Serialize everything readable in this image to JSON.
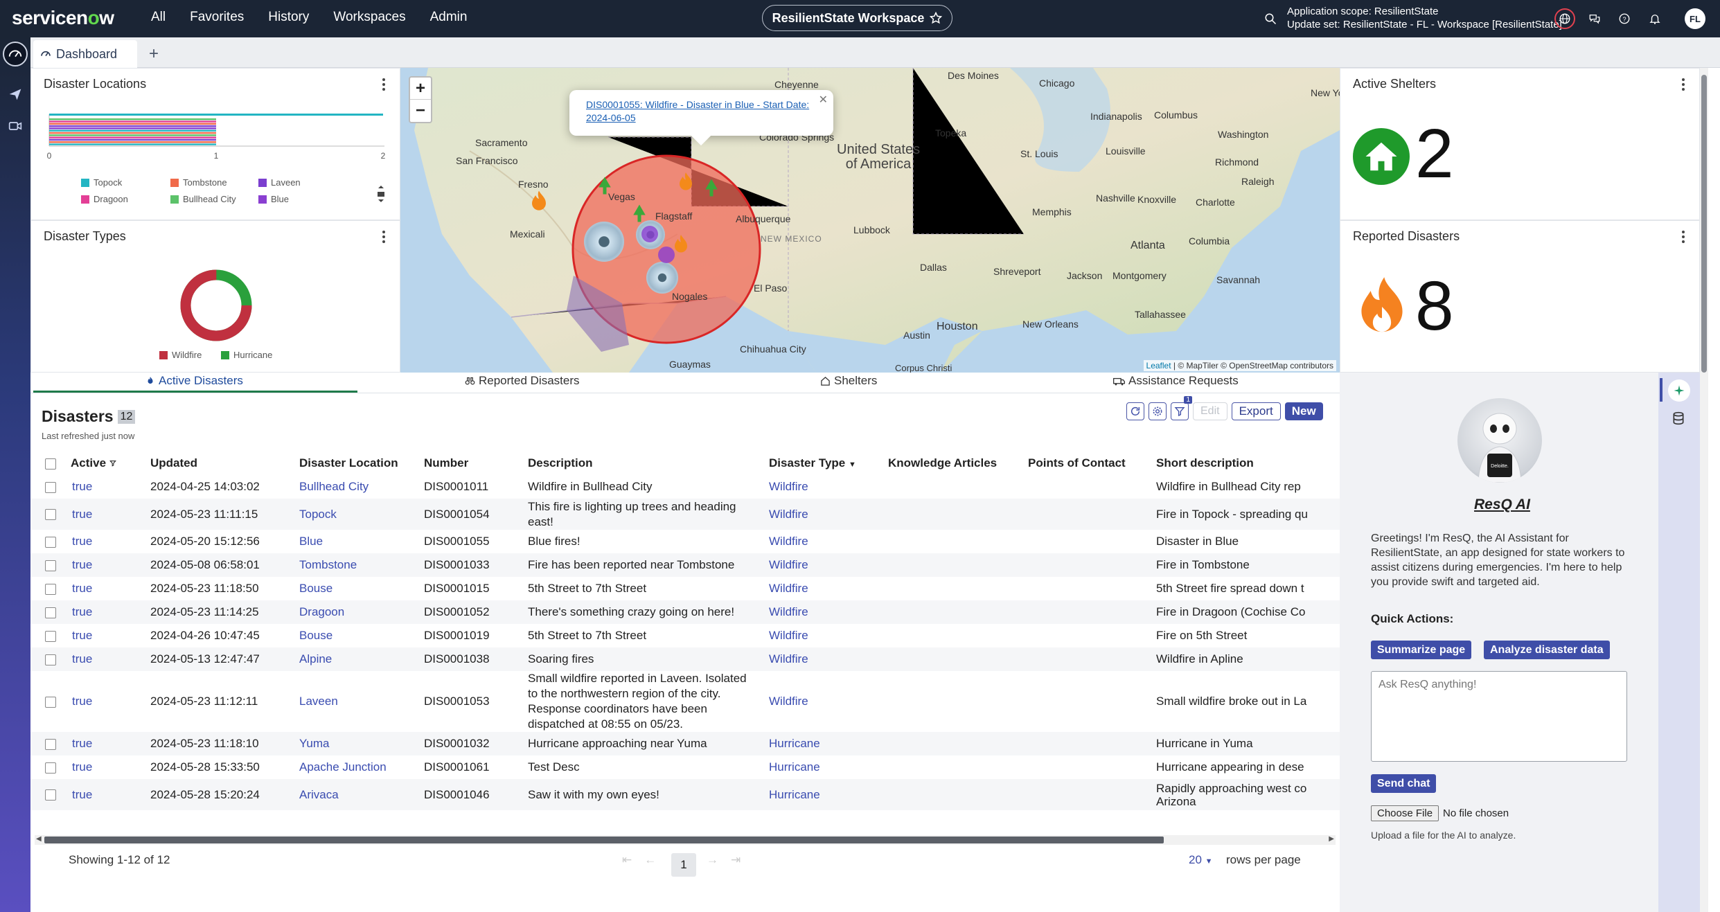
{
  "topnav": {
    "logo_a": "servicen",
    "logo_o": "o",
    "logo_b": "w",
    "menu": [
      "All",
      "Favorites",
      "History",
      "Workspaces",
      "Admin"
    ],
    "workspace": "ResilientState Workspace",
    "scope_line1": "Application scope: ResilientState",
    "scope_line2": "Update set: ResilientState - FL - Workspace [ResilientState]",
    "avatar": "FL"
  },
  "tabs": {
    "dashboard": "Dashboard"
  },
  "disaster_locations": {
    "title": "Disaster Locations",
    "axis_ticks": [
      "0",
      "1",
      "2"
    ],
    "legend": [
      {
        "label": "Topock",
        "color": "#23b5c3"
      },
      {
        "label": "Tombstone",
        "color": "#f06a4a"
      },
      {
        "label": "Laveen",
        "color": "#7b3fcf"
      },
      {
        "label": "Dragoon",
        "color": "#e33f96"
      },
      {
        "label": "Bullhead City",
        "color": "#5cc26a"
      },
      {
        "label": "Blue",
        "color": "#8a3fd1"
      }
    ]
  },
  "disaster_types": {
    "title": "Disaster Types",
    "legend": [
      {
        "label": "Wildfire",
        "color": "#c0303f"
      },
      {
        "label": "Hurricane",
        "color": "#2aa03c"
      }
    ],
    "wildfire_share": 0.75
  },
  "map": {
    "popup": "DIS0001055: Wildfire - Disaster in Blue - Start Date: 2024-06-05",
    "attribution_a": "Leaflet",
    "attribution_b": " | © MapTiler © OpenStreetMap contributors",
    "labels": {
      "cheyenne": "Cheyenne",
      "desmoines": "Des Moines",
      "sacramento": "Sacramento",
      "sanfrancisco": "San Francisco",
      "fresno": "Fresno",
      "lasvegas": "Vegas",
      "flagstaff": "Flagstaff",
      "albuquerque": "Albuquerque",
      "newmexico": "NEW MEXICO",
      "colorado": "Colorado Springs",
      "usa1": "United States",
      "usa2": "of America",
      "topeka": "Topeka",
      "chicago": "Chicago",
      "indianapolis": "Indianapolis",
      "columbus": "Columbus",
      "washington": "Washington",
      "stlouis": "St. Louis",
      "louisville": "Louisville",
      "richmond": "Richmond",
      "nashville": "Nashville",
      "knoxville": "Knoxville",
      "charlotte": "Charlotte",
      "memphis": "Memphis",
      "raleigh": "Raleigh",
      "atlanta": "Atlanta",
      "columbia": "Columbia",
      "lubbock": "Lubbock",
      "dallas": "Dallas",
      "shreveport": "Shreveport",
      "jackson": "Jackson",
      "montgomery": "Montgomery",
      "savannah": "Savannah",
      "elpaso": "El Paso",
      "austin": "Austin",
      "houston": "Houston",
      "neworleans": "New Orleans",
      "tallahassee": "Tallahassee",
      "nogales": "Nogales",
      "chihuahua": "Chihuahua City",
      "corpus": "Corpus Christi",
      "guaymas": "Guaymas",
      "mexicali": "Mexicali",
      "newyork": "New Yo"
    }
  },
  "active_shelters": {
    "title": "Active Shelters",
    "count": "2"
  },
  "reported_disasters": {
    "title": "Reported Disasters",
    "count": "8"
  },
  "subtabs": [
    "Active Disasters",
    "Reported Disasters",
    "Shelters",
    "Assistance Requests"
  ],
  "list": {
    "title": "Disasters",
    "count": "12",
    "refreshed": "Last refreshed just now",
    "buttons": {
      "edit": "Edit",
      "export": "Export",
      "new": "New"
    },
    "filter_badge": "1",
    "columns": [
      "Active",
      "Updated",
      "Disaster Location",
      "Number",
      "Description",
      "Disaster Type",
      "Knowledge Articles",
      "Points of Contact",
      "Short description"
    ],
    "rows": [
      {
        "active": "true",
        "updated": "2024-04-25 14:03:02",
        "location": "Bullhead City",
        "number": "DIS0001011",
        "description": "Wildfire in Bullhead City",
        "type": "Wildfire",
        "short": "Wildfire in Bullhead City rep"
      },
      {
        "active": "true",
        "updated": "2024-05-23 11:11:15",
        "location": "Topock",
        "number": "DIS0001054",
        "description": "This fire is lighting up trees and heading east!",
        "type": "Wildfire",
        "short": "Fire in Topock - spreading qu"
      },
      {
        "active": "true",
        "updated": "2024-05-20 15:12:56",
        "location": "Blue",
        "number": "DIS0001055",
        "description": "Blue fires!",
        "type": "Wildfire",
        "short": "Disaster in Blue"
      },
      {
        "active": "true",
        "updated": "2024-05-08 06:58:01",
        "location": "Tombstone",
        "number": "DIS0001033",
        "description": "Fire has been reported near Tombstone",
        "type": "Wildfire",
        "short": "Fire in Tombstone"
      },
      {
        "active": "true",
        "updated": "2024-05-23 11:18:50",
        "location": "Bouse",
        "number": "DIS0001015",
        "description": "5th Street to 7th Street",
        "type": "Wildfire",
        "short": "5th Street fire spread down t"
      },
      {
        "active": "true",
        "updated": "2024-05-23 11:14:25",
        "location": "Dragoon",
        "number": "DIS0001052",
        "description": "There's something crazy going on here!",
        "type": "Wildfire",
        "short": "Fire in Dragoon (Cochise Co"
      },
      {
        "active": "true",
        "updated": "2024-04-26 10:47:45",
        "location": "Bouse",
        "number": "DIS0001019",
        "description": "5th Street to 7th Street",
        "type": "Wildfire",
        "short": "Fire on 5th Street"
      },
      {
        "active": "true",
        "updated": "2024-05-13 12:47:47",
        "location": "Alpine",
        "number": "DIS0001038",
        "description": "Soaring fires",
        "type": "Wildfire",
        "short": "Wildfire in Apline"
      },
      {
        "active": "true",
        "updated": "2024-05-23 11:12:11",
        "location": "Laveen",
        "number": "DIS0001053",
        "description": "Small wildfire reported in Laveen. Isolated to the northwestern region of the city. Response coordinators have been dispatched at 08:55 on 05/23.",
        "type": "Wildfire",
        "short": "Small wildfire broke out in La"
      },
      {
        "active": "true",
        "updated": "2024-05-23 11:18:10",
        "location": "Yuma",
        "number": "DIS0001032",
        "description": "Hurricane approaching near Yuma",
        "type": "Hurricane",
        "short": "Hurricane in Yuma"
      },
      {
        "active": "true",
        "updated": "2024-05-28 15:33:50",
        "location": "Apache Junction",
        "number": "DIS0001061",
        "description": "Test Desc",
        "type": "Hurricane",
        "short": "Hurricane appearing in dese"
      },
      {
        "active": "true",
        "updated": "2024-05-28 15:20:24",
        "location": "Arivaca",
        "number": "DIS0001046",
        "description": "Saw it with my own eyes!",
        "type": "Hurricane",
        "short": "Rapidly approaching west co Arizona"
      }
    ],
    "showing": "Showing 1-12 of 12",
    "page": "1",
    "rows_per_page_value": "20",
    "rows_per_page_label": "rows per page"
  },
  "chat": {
    "title": "ResQ AI",
    "greeting": "Greetings! I'm ResQ, the AI Assistant for ResilientState, an app designed for state workers to assist citizens during emergencies. I'm here to help you provide swift and targeted aid.",
    "quick_actions": "Quick Actions:",
    "summarize": "Summarize page",
    "analyze": "Analyze disaster data",
    "placeholder": "Ask ResQ anything!",
    "send": "Send chat",
    "choose_file": "Choose File",
    "no_file": "No file chosen",
    "upload_note": "Upload a file for the AI to analyze.",
    "robot_badge": "Deloitte."
  }
}
